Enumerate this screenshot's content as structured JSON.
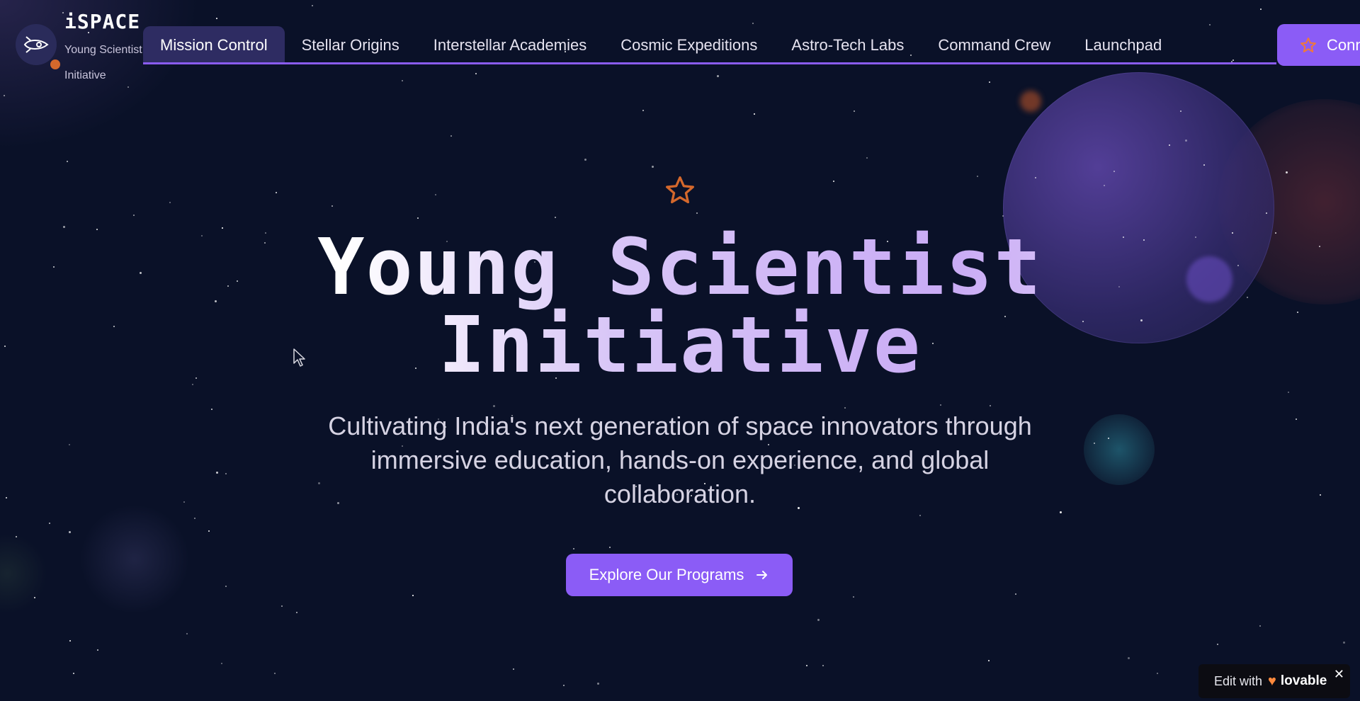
{
  "brand": {
    "title": "iSPACE",
    "subtitle": "Young Scientist Initiative",
    "logo_icon": "rocket-icon"
  },
  "nav": {
    "items": [
      {
        "label": "Mission Control",
        "active": true
      },
      {
        "label": "Stellar Origins",
        "active": false
      },
      {
        "label": "Interstellar Academies",
        "active": false
      },
      {
        "label": "Cosmic Expeditions",
        "active": false
      },
      {
        "label": "Astro-Tech Labs",
        "active": false
      },
      {
        "label": "Command Crew",
        "active": false
      },
      {
        "label": "Launchpad",
        "active": false
      }
    ],
    "cta_label": "Conn",
    "cta_icon": "star-icon"
  },
  "hero": {
    "icon": "star-icon",
    "title_line1": "Young Scientist",
    "title_line2": "Initiative",
    "subtitle": "Cultivating India's next generation of space innovators through immersive education, hands-on experience, and global collaboration.",
    "cta_label": "Explore Our Programs",
    "cta_icon": "arrow-right-icon"
  },
  "badge": {
    "prefix": "Edit with",
    "brand": "lovable",
    "close": "✕"
  },
  "colors": {
    "background": "#0a1128",
    "accent": "#8b5cf6",
    "star_accent": "#d4682c"
  }
}
